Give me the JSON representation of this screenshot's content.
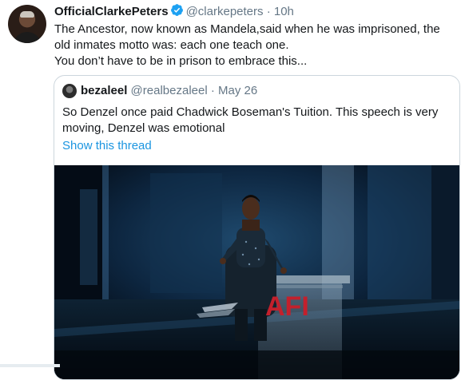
{
  "tweet": {
    "display_name": "OfficialClarkePeters",
    "handle": "@clarkepeters",
    "separator": "·",
    "time": "10h",
    "text_lines": [
      "The Ancestor, now known as Mandela,said when he was imprisoned,  the",
      "old inmates motto was: each one teach one.",
      "You don’t have to be in prison to embrace this..."
    ],
    "avatar_icon": "profile-photo",
    "verified_icon": "verified-badge-icon"
  },
  "quoted_tweet": {
    "display_name": "bezaleel",
    "handle": "@realbezaleel",
    "separator": "·",
    "date": "May 26",
    "text_lines": [
      "So Denzel once paid Chadwick Boseman's Tuition. This speech is very",
      "moving, Denzel was emotional"
    ],
    "show_thread_label": "Show this thread",
    "media": {
      "sign_text": "AFI"
    }
  },
  "colors": {
    "text": "#14171a",
    "secondary": "#657786",
    "link": "#1b95e0",
    "verified": "#1da1f2",
    "border": "#ccd6dd",
    "afi_red": "#c3202c"
  }
}
